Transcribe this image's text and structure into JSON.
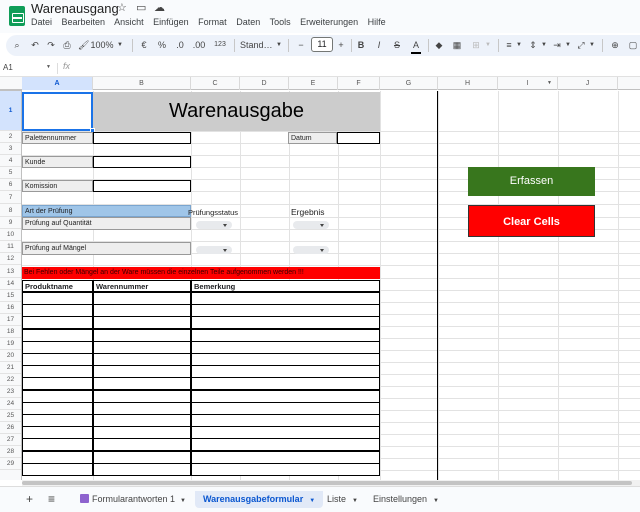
{
  "app": {
    "doc_title": "Warenausgang",
    "menu": [
      "Datei",
      "Bearbeiten",
      "Ansicht",
      "Einfügen",
      "Format",
      "Daten",
      "Tools",
      "Erweiterungen",
      "Hilfe"
    ]
  },
  "toolbar": {
    "zoom": "100%",
    "currency": "€",
    "percent": "%",
    "dec_decrease": ".0",
    "dec_increase": ".00",
    "number_format": "123",
    "font": "Stand…",
    "font_size": "11",
    "minus": "−",
    "plus": "+"
  },
  "formula_bar": {
    "cell_ref": "A1",
    "fx": "fx"
  },
  "columns": [
    "A",
    "B",
    "C",
    "D",
    "E",
    "F",
    "G",
    "H",
    "I",
    "J"
  ],
  "rows": [
    "1",
    "2",
    "3",
    "4",
    "5",
    "6",
    "7",
    "8",
    "9",
    "10",
    "11",
    "12",
    "13",
    "14",
    "15",
    "16",
    "17",
    "18",
    "19",
    "20",
    "21",
    "22",
    "23",
    "24",
    "25",
    "26",
    "27",
    "28",
    "29"
  ],
  "sheet": {
    "title": "Warenausgabe",
    "palettennummer": "Palettennummer",
    "datum": "Datum",
    "kunde": "Kunde",
    "komission": "Komission",
    "art_der_pruefung": "Art der Prüfung",
    "pruefungsstatus": "Prüfungsstatus",
    "ergebnis": "Ergebnis",
    "pruefung_quantitaet": "Prüfung auf Quantität",
    "pruefung_maengel": "Prüfung auf Mängel",
    "warning": "Bei Fehlen oder Mängel an der Ware müssen die einzelnen Teile aufgenommen werden !!!",
    "table_headers": [
      "Produktname",
      "Warennummer",
      "Bemerkung"
    ]
  },
  "buttons": {
    "erfassen": "Erfassen",
    "clear": "Clear Cells",
    "erfassen_color": "#38761d",
    "clear_color": "#ff0000"
  },
  "tabs": {
    "add": "+",
    "list": "≡",
    "items": [
      "Formularantworten 1",
      "Warenausgabeformular",
      "Liste",
      "Einstellungen"
    ],
    "active": "Warenausgabeformular"
  }
}
